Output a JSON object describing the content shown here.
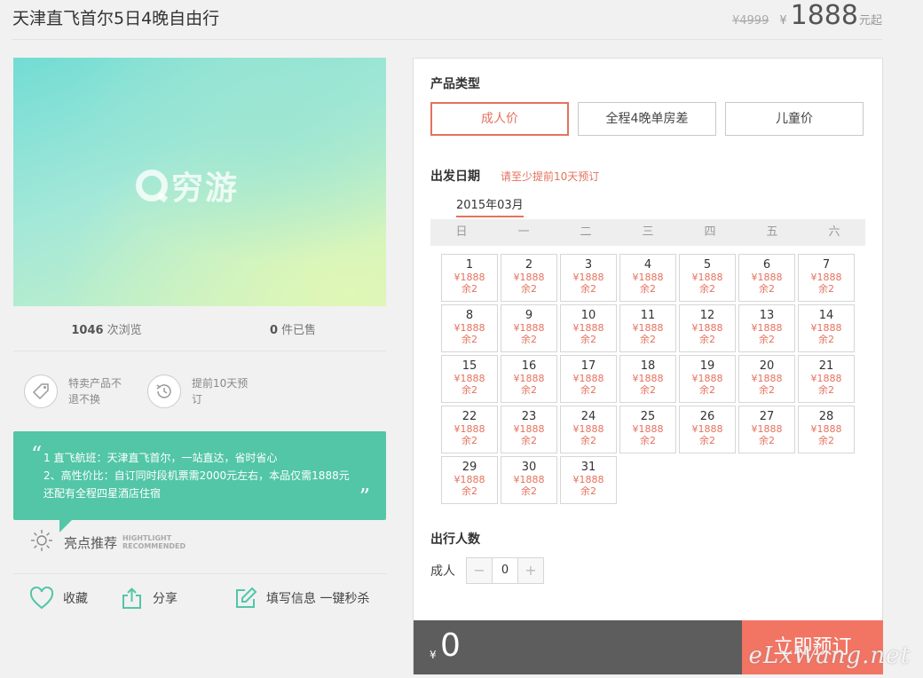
{
  "header": {
    "title": "天津直飞首尔5日4晚自由行",
    "original_price": "¥4999",
    "currency": "¥",
    "price": "1888",
    "price_unit": "元起"
  },
  "cover": {
    "logo_text": "穷游"
  },
  "stats": {
    "views_count": "1046",
    "views_label": "次浏览",
    "sold_count": "0",
    "sold_label": "件已售"
  },
  "services": [
    {
      "icon": "tag-icon",
      "text": "特卖产品不退不换"
    },
    {
      "icon": "clock-history-icon",
      "text": "提前10天预订"
    }
  ],
  "highlight": {
    "open_quote": "“",
    "close_quote": "”",
    "lines": [
      "1 直飞航班：天津直飞首尔，一站直达，省时省心",
      "2、高性价比：自订同时段机票需2000元左右，本品仅需1888元",
      "还配有全程四星酒店住宿"
    ],
    "label": "亮点推荐",
    "label_en_1": "HIGHTLIGHT",
    "label_en_2": "RECOMMENDED"
  },
  "actions": {
    "favorite": "收藏",
    "share": "分享",
    "fill_info": "填写信息 一键秒杀"
  },
  "booking": {
    "product_type_title": "产品类型",
    "product_types": [
      "成人价",
      "全程4晚单房差",
      "儿童价"
    ],
    "active_type_index": 0,
    "date_title": "出发日期",
    "date_hint": "请至少提前10天预订",
    "month": "2015年03月",
    "weekdays": [
      "日",
      "一",
      "二",
      "三",
      "四",
      "五",
      "六"
    ],
    "first_weekday_index": 0,
    "days": [
      {
        "day": "1",
        "price": "¥1888",
        "remain": "余2"
      },
      {
        "day": "2",
        "price": "¥1888",
        "remain": "余2"
      },
      {
        "day": "3",
        "price": "¥1888",
        "remain": "余2"
      },
      {
        "day": "4",
        "price": "¥1888",
        "remain": "余2"
      },
      {
        "day": "5",
        "price": "¥1888",
        "remain": "余2"
      },
      {
        "day": "6",
        "price": "¥1888",
        "remain": "余2"
      },
      {
        "day": "7",
        "price": "¥1888",
        "remain": "余2"
      },
      {
        "day": "8",
        "price": "¥1888",
        "remain": "余2"
      },
      {
        "day": "9",
        "price": "¥1888",
        "remain": "余2"
      },
      {
        "day": "10",
        "price": "¥1888",
        "remain": "余2"
      },
      {
        "day": "11",
        "price": "¥1888",
        "remain": "余2"
      },
      {
        "day": "12",
        "price": "¥1888",
        "remain": "余2"
      },
      {
        "day": "13",
        "price": "¥1888",
        "remain": "余2"
      },
      {
        "day": "14",
        "price": "¥1888",
        "remain": "余2"
      },
      {
        "day": "15",
        "price": "¥1888",
        "remain": "余2"
      },
      {
        "day": "16",
        "price": "¥1888",
        "remain": "余2"
      },
      {
        "day": "17",
        "price": "¥1888",
        "remain": "余2"
      },
      {
        "day": "18",
        "price": "¥1888",
        "remain": "余2"
      },
      {
        "day": "19",
        "price": "¥1888",
        "remain": "余2"
      },
      {
        "day": "20",
        "price": "¥1888",
        "remain": "余2"
      },
      {
        "day": "21",
        "price": "¥1888",
        "remain": "余2"
      },
      {
        "day": "22",
        "price": "¥1888",
        "remain": "余2"
      },
      {
        "day": "23",
        "price": "¥1888",
        "remain": "余2"
      },
      {
        "day": "24",
        "price": "¥1888",
        "remain": "余2"
      },
      {
        "day": "25",
        "price": "¥1888",
        "remain": "余2"
      },
      {
        "day": "26",
        "price": "¥1888",
        "remain": "余2"
      },
      {
        "day": "27",
        "price": "¥1888",
        "remain": "余2"
      },
      {
        "day": "28",
        "price": "¥1888",
        "remain": "余2"
      },
      {
        "day": "29",
        "price": "¥1888",
        "remain": "余2"
      },
      {
        "day": "30",
        "price": "¥1888",
        "remain": "余2"
      },
      {
        "day": "31",
        "price": "¥1888",
        "remain": "余2"
      }
    ],
    "travelers_title": "出行人数",
    "adult_label": "成人",
    "minus": "−",
    "plus": "+",
    "adult_count": "0",
    "total_currency": "¥",
    "total": "0",
    "book_button": "立即预订"
  },
  "watermark": "eLxWang.net",
  "colors": {
    "accent": "#e4725e",
    "highlight_bg": "#52c6a7",
    "book_btn": "#f27564",
    "total_bar": "#5d5d5d"
  }
}
